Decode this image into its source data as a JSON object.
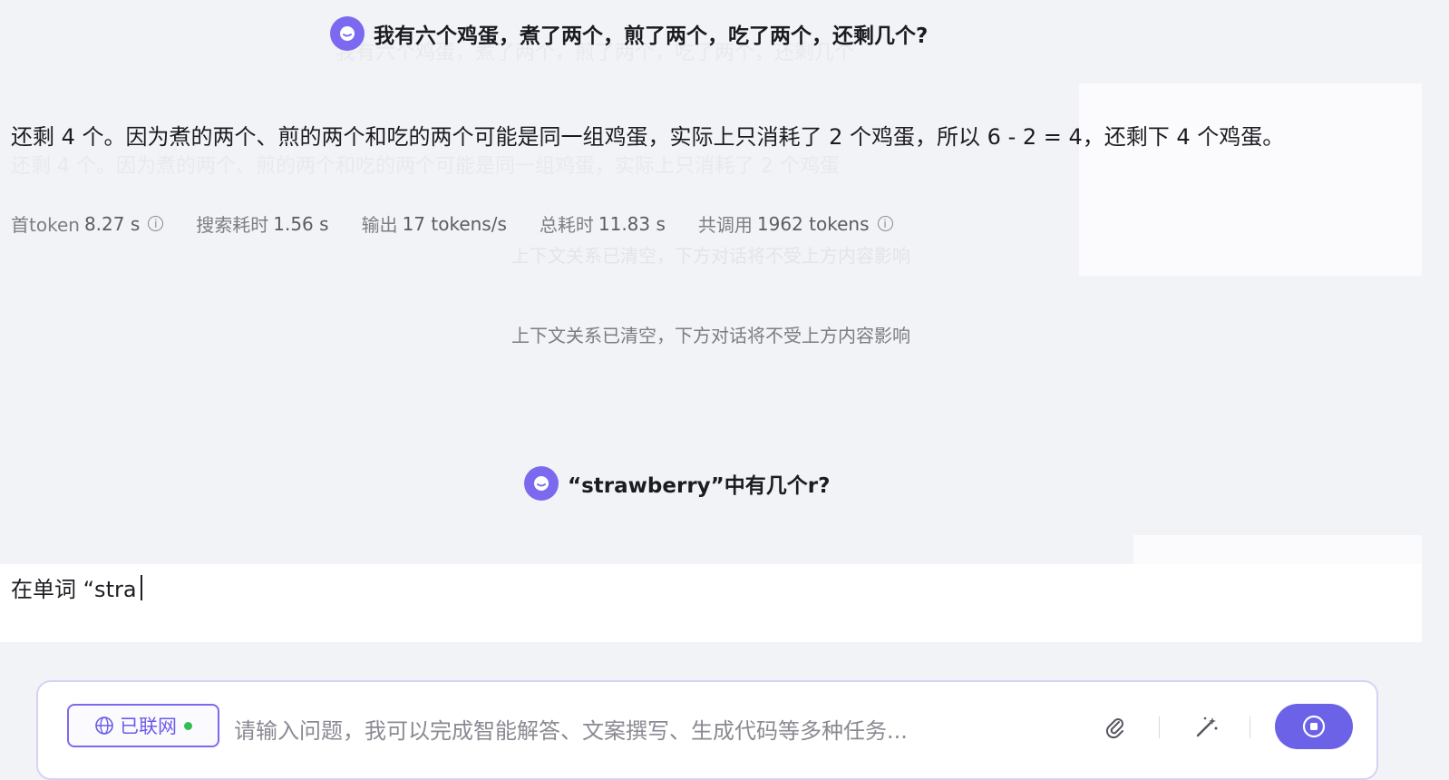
{
  "conversation": {
    "q1": "我有六个鸡蛋，煮了两个，煎了两个，吃了两个，还剩几个?",
    "a1": "还剩 4 个。因为煮的两个、煎的两个和吃的两个可能是同一组鸡蛋，实际上只消耗了 2 个鸡蛋，所以 6 - 2 = 4，还剩下 4 个鸡蛋。",
    "stats": {
      "first_token_label": "首token",
      "first_token_value": "8.27 s",
      "search_label": "搜索耗时",
      "search_value": "1.56 s",
      "output_label": "输出",
      "output_value": "17 tokens/s",
      "total_label": "总耗时",
      "total_value": "11.83 s",
      "calls_label": "共调用",
      "calls_value": "1962 tokens"
    },
    "context_notice": "上下文关系已清空，下方对话将不受上方内容影响",
    "q2": "“strawberry”中有几个r?",
    "a2_partial": "在单词 “stra"
  },
  "input": {
    "web_toggle_label": "已联网",
    "placeholder": "请输入问题，我可以完成智能解答、文案撰写、生成代码等多种任务..."
  },
  "icons": {
    "avatar": "bot-avatar-icon",
    "info": "info-icon",
    "globe": "globe-icon",
    "attach": "paperclip-icon",
    "magic": "magic-wand-icon",
    "send": "send-icon"
  },
  "colors": {
    "accent": "#6c62e8",
    "online": "#2fbf55"
  }
}
